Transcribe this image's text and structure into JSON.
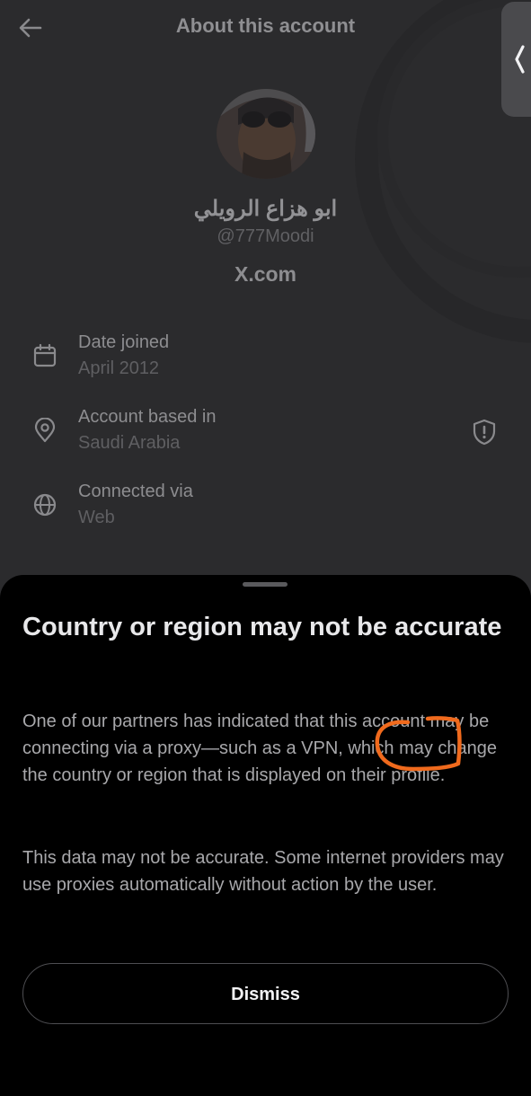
{
  "header": {
    "title": "About this account"
  },
  "profile": {
    "display_name": "ابو هزاع الرويلي",
    "handle": "@777Moodi",
    "domain": "X.com"
  },
  "details": [
    {
      "icon": "calendar-icon",
      "label": "Date joined",
      "value": "April 2012"
    },
    {
      "icon": "location-pin-icon",
      "label": "Account based in",
      "value": "Saudi Arabia"
    },
    {
      "icon": "globe-icon",
      "label": "Connected via",
      "value": "Web"
    }
  ],
  "sheet": {
    "title": "Country or region may not be accurate",
    "paragraph1": "One of our partners has indicated that this account may be connecting via a proxy—such as a VPN, which may change the country or region that is displayed on their profile.",
    "paragraph2": "This data may not be accurate. Some internet providers may use proxies automatically without action by the user.",
    "dismiss_label": "Dismiss"
  },
  "colors": {
    "sheet_background": "#000000",
    "annotation": "#f06a1d"
  }
}
